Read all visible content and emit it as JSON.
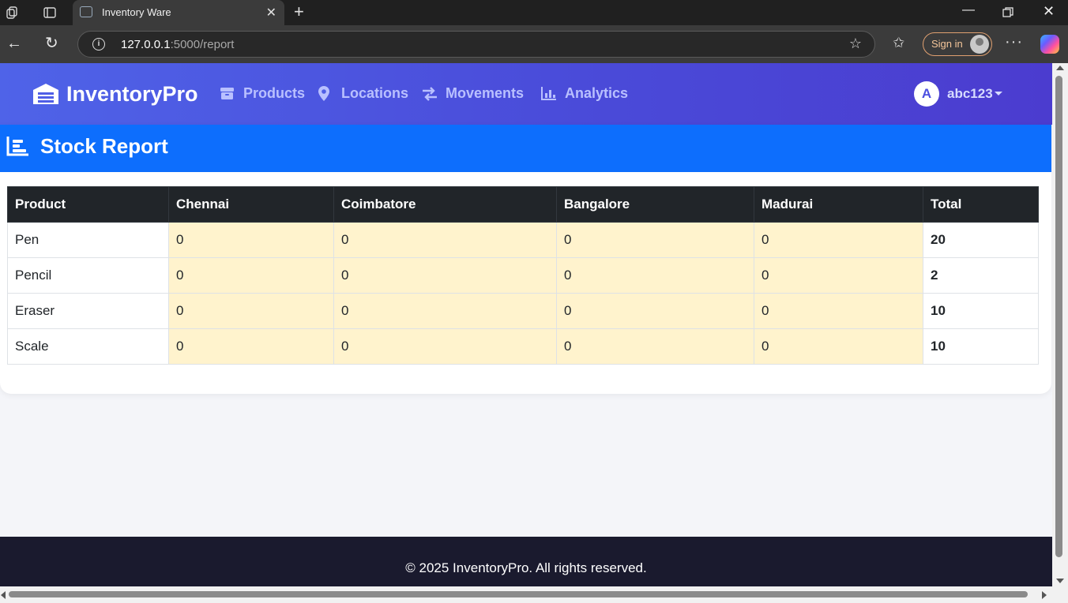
{
  "browser": {
    "tab_title": "Inventory Ware",
    "url_host": "127.0.0.1",
    "url_rest": ":5000/report",
    "signin_label": "Sign in",
    "icons": [
      "workspaces-icon",
      "tab-actions-icon",
      "terminal-favicon",
      "close-icon",
      "new-tab-icon",
      "minimize-icon",
      "restore-icon",
      "window-close-icon",
      "back-icon",
      "refresh-icon",
      "info-icon",
      "star-icon",
      "favorites-icon",
      "profile-icon",
      "more-icon",
      "copilot-icon"
    ]
  },
  "navbar": {
    "brand": "InventoryPro",
    "items": [
      {
        "label": "Products",
        "icon": "box-icon"
      },
      {
        "label": "Locations",
        "icon": "map-pin-icon"
      },
      {
        "label": "Movements",
        "icon": "exchange-icon"
      },
      {
        "label": "Analytics",
        "icon": "chart-icon"
      }
    ],
    "user_initial": "A",
    "username": "abc123",
    "colors": {
      "gradient_start": "#4f63e8",
      "gradient_end": "#4b3ccf",
      "link": "#b9c0ff"
    }
  },
  "report": {
    "title": "Stock Report",
    "header_color": "#0d6efd",
    "columns": [
      "Product",
      "Chennai",
      "Coimbatore",
      "Bangalore",
      "Madurai",
      "Total"
    ],
    "rows": [
      {
        "product": "Pen",
        "chennai": "0",
        "coimbatore": "0",
        "bangalore": "0",
        "madurai": "0",
        "total": "20"
      },
      {
        "product": "Pencil",
        "chennai": "0",
        "coimbatore": "0",
        "bangalore": "0",
        "madurai": "0",
        "total": "2"
      },
      {
        "product": "Eraser",
        "chennai": "0",
        "coimbatore": "0",
        "bangalore": "0",
        "madurai": "0",
        "total": "10"
      },
      {
        "product": "Scale",
        "chennai": "0",
        "coimbatore": "0",
        "bangalore": "0",
        "madurai": "0",
        "total": "10"
      }
    ],
    "location_cell_color": "#fff3cd"
  },
  "footer": {
    "text": "© 2025 InventoryPro. All rights reserved."
  }
}
